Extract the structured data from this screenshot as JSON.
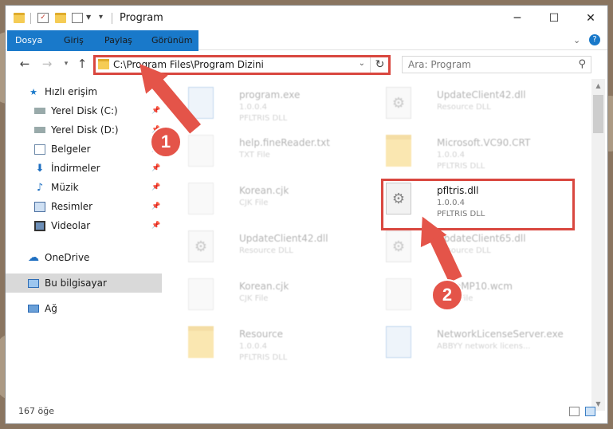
{
  "window": {
    "title": "Program"
  },
  "ribbon": {
    "tabs": [
      "Dosya",
      "Giriş",
      "Paylaş",
      "Görünüm"
    ]
  },
  "address": {
    "path": "C:\\Program Files\\Program Dizini"
  },
  "search": {
    "placeholder": "Ara: Program"
  },
  "sidebar": {
    "items": [
      {
        "label": "Hızlı erişim",
        "icon": "star-icon"
      },
      {
        "label": "Yerel Disk (C:)",
        "icon": "disk-icon"
      },
      {
        "label": "Yerel Disk (D:)",
        "icon": "disk-icon"
      },
      {
        "label": "Belgeler",
        "icon": "documents-icon"
      },
      {
        "label": "İndirmeler",
        "icon": "download-icon"
      },
      {
        "label": "Müzik",
        "icon": "music-icon"
      },
      {
        "label": "Resimler",
        "icon": "pictures-icon"
      },
      {
        "label": "Videolar",
        "icon": "videos-icon"
      },
      {
        "label": "OneDrive",
        "icon": "cloud-icon"
      },
      {
        "label": "Bu bilgisayar",
        "icon": "computer-icon"
      },
      {
        "label": "Ağ",
        "icon": "network-icon"
      }
    ]
  },
  "files": {
    "left": [
      {
        "name": "program.exe",
        "l2": "1.0.0.4",
        "l3": "PFLTRIS DLL"
      },
      {
        "name": "help.fineReader.txt",
        "l2": "TXT File",
        "l3": ""
      },
      {
        "name": "Korean.cjk",
        "l2": "CJK File",
        "l3": ""
      },
      {
        "name": "UpdateClient42.dll",
        "l2": "Resource DLL",
        "l3": ""
      },
      {
        "name": "Korean.cjk",
        "l2": "CJK File",
        "l3": ""
      },
      {
        "name": "Resource",
        "l2": "1.0.0.4",
        "l3": "PFLTRIS DLL"
      }
    ],
    "right": [
      {
        "name": "UpdateClient42.dll",
        "l2": "Resource DLL",
        "l3": ""
      },
      {
        "name": "Microsoft.VC90.CRT",
        "l2": "1.0.0.4",
        "l3": "PFLTRIS DLL"
      },
      {
        "name": "pfltris.dll",
        "l2": "1.0.0.4",
        "l3": "PFLTRIS DLL"
      },
      {
        "name": "UpdateClient65.dll",
        "l2": "Resource DLL",
        "l3": ""
      },
      {
        "name": "SnapMP10.wcm",
        "l2": "WCM File",
        "l3": ""
      },
      {
        "name": "NetworkLicenseServer.exe",
        "l2": "ABBYY network licens...",
        "l3": ""
      }
    ]
  },
  "status": {
    "count": "167 öğe"
  },
  "callouts": {
    "one": "1",
    "two": "2"
  },
  "colors": {
    "accent": "#1979ca",
    "highlight": "#d9473f",
    "arrow": "#e45449"
  }
}
